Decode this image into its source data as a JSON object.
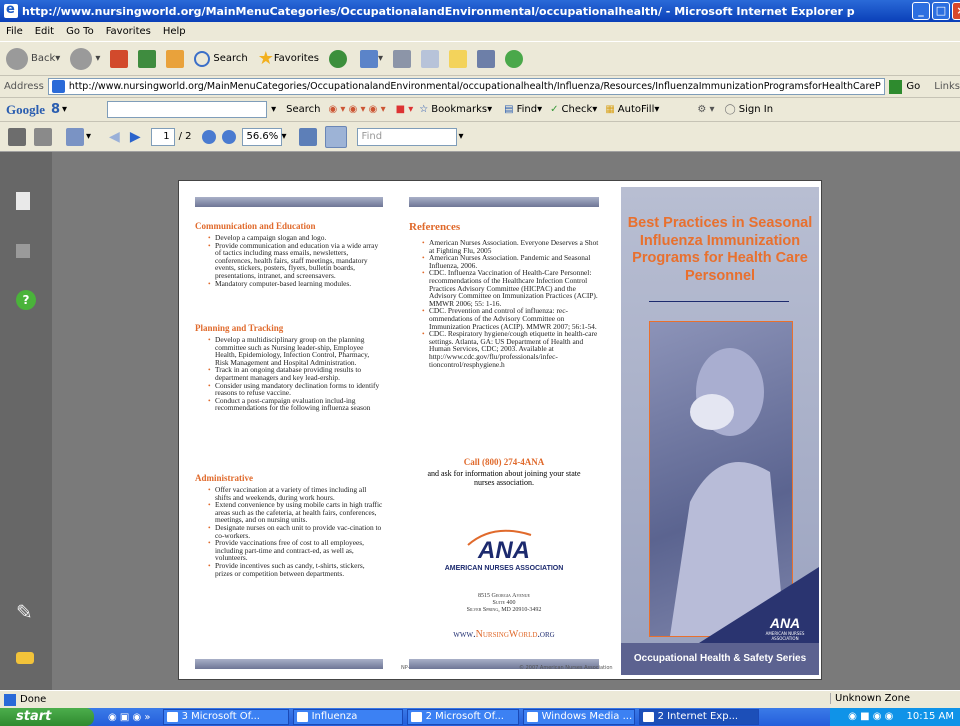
{
  "window": {
    "title": "http://www.nursingworld.org/MainMenuCategories/OccupationalandEnvironmental/occupationalhealth/ - Microsoft Internet Explorer p"
  },
  "menu": [
    "File",
    "Edit",
    "Go To",
    "Favorites",
    "Help"
  ],
  "toolbar": {
    "back": "Back",
    "search": "Search",
    "favorites": "Favorites"
  },
  "address": {
    "label": "Address",
    "url": "http://www.nursingworld.org/MainMenuCategories/OccupationalandEnvironmental/occupationalhealth/Influenza/Resources/InfluenzaImmunizationProgramsforHealthCareP",
    "go": "Go",
    "links": "Links"
  },
  "google": {
    "logo": "Google",
    "g_label": "8",
    "search": "Search",
    "bookmarks": "Bookmarks",
    "find": "Find",
    "check": "Check",
    "autofill": "AutoFill",
    "signin": "Sign In"
  },
  "pdf": {
    "page": "1",
    "pages": "/ 2",
    "zoom": "56.6%",
    "find_placeholder": "Find"
  },
  "brochure": {
    "col1": {
      "sections": [
        {
          "heading": "Communication and Education",
          "items": [
            "Develop a campaign slogan and logo.",
            "Provide communication and education via a wide array of tactics including mass emails, newsletters, conferences, health fairs, staff meetings, mandatory events, stickers, posters, flyers, bulletin boards, presentations, intranet, and screensavers.",
            "Mandatory computer-based learning modules."
          ]
        },
        {
          "heading": "Planning and Tracking",
          "items": [
            "Develop a multidisciplinary group on the planning committee such as Nursing leader-ship, Employee Health, Epidemiology, Infection Control, Pharmacy, Risk Management and Hospital Administration.",
            "Track in an ongoing database providing results to department managers and key lead-ership.",
            "Consider using mandatory declination forms to identify reasons to refuse vaccine.",
            "Conduct a post-campaign evaluation includ-ing recommendations for the following influenza season"
          ]
        },
        {
          "heading": "Administrative",
          "items": [
            "Offer vaccination at a variety of times including all shifts and weekends, during work hours.",
            "Extend convenience by using mobile carts in high traffic areas such as the cafeteria, at health fairs, conferences, meetings, and on nursing units.",
            "Designate nurses on each unit to provide vac-cination to co-workers.",
            "Provide vaccinations free of cost to all employees, including part-time and contract-ed, as well as, volunteers.",
            "Provide incentives such as candy, t-shirts, stickers, prizes or competition between departments."
          ]
        }
      ],
      "footer_code": "NP-8"
    },
    "col2": {
      "heading": "References",
      "items": [
        "American Nurses Association. Everyone Deserves a Shot at Fighting Flu, 2005",
        "American Nurses Association. Pandemic and Seasonal Influenza, 2006.",
        "CDC. Influenza Vaccination of Health-Care Personnel: recommendations of the Healthcare Infection Control Practices Advisory Committee (HICPAC) and the Advisory Committee on Immunization Practices (ACIP). MMWR 2006; 55: 1-16.",
        "CDC. Prevention and control of influenza: rec-ommendations of the Advisory Committee on Immunization Practices (ACIP). MMWR 2007; 56:1-54.",
        "CDC. Respiratory hygiene/cough etiquette in health-care settings. Atlanta, GA: US Department of Health and Human Services, CDC; 2003. Available at http://www.cdc.gov/flu/professionals/infec-tioncontrol/resphygiene.h"
      ],
      "call": "Call (800) 274-4ANA",
      "call_sub": "and ask for information about joining your state nurses association.",
      "logo_text": "ANA",
      "org": "AMERICAN NURSES ASSOCIATION",
      "addr1": "8515 Georgia Avenue",
      "addr2": "Suite 400",
      "addr3": "Silver Spring, MD 20910-3492",
      "web_prefix": "www.",
      "web_main": "NursingWorld",
      "web_suffix": ".org",
      "copyright": "© 2007 American Nurses Association"
    },
    "col3": {
      "title": "Best Practices in Seasonal Influenza Immunization Programs for Health Care Personnel",
      "corner_logo": "ANA",
      "corner_org": "AMERICAN NURSES ASSOCIATION",
      "series": "Occupational Health & Safety Series"
    }
  },
  "status": {
    "text": "Done",
    "zone": "Unknown Zone"
  },
  "taskbar": {
    "start": "start",
    "tasks": [
      "3 Microsoft Of...",
      "Influenza",
      "2 Microsoft Of...",
      "Windows Media ...",
      "2 Internet Exp..."
    ],
    "time": "10:15 AM"
  }
}
